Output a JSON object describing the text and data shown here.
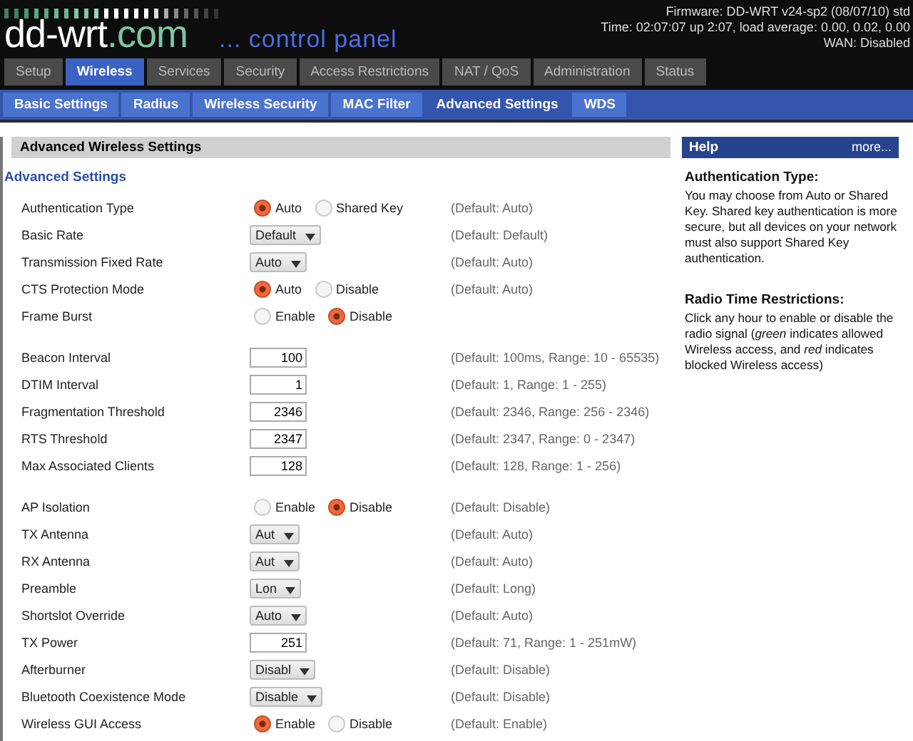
{
  "logo": {
    "name": "dd-wrt",
    "suffix": ".com",
    "tagline": "... control panel"
  },
  "status": [
    "Firmware: DD-WRT v24-sp2 (08/07/10) std",
    "Time: 02:07:07 up 2:07, load average: 0.00, 0.02, 0.00",
    "WAN: Disabled"
  ],
  "tabs": [
    {
      "label": "Setup",
      "selected": false
    },
    {
      "label": "Wireless",
      "selected": true
    },
    {
      "label": "Services",
      "selected": false
    },
    {
      "label": "Security",
      "selected": false
    },
    {
      "label": "Access Restrictions",
      "selected": false
    },
    {
      "label": "NAT / QoS",
      "selected": false
    },
    {
      "label": "Administration",
      "selected": false
    },
    {
      "label": "Status",
      "selected": false
    }
  ],
  "subtabs": [
    {
      "label": "Basic Settings",
      "selected": false
    },
    {
      "label": "Radius",
      "selected": false
    },
    {
      "label": "Wireless Security",
      "selected": false
    },
    {
      "label": "MAC Filter",
      "selected": false
    },
    {
      "label": "Advanced Settings",
      "selected": true
    },
    {
      "label": "WDS",
      "selected": false
    }
  ],
  "section_title": "Advanced Wireless Settings",
  "legend": "Advanced Settings",
  "groups": [
    [
      {
        "label": "Authentication Type",
        "kind": "radio",
        "options": [
          {
            "label": "Auto",
            "selected": true
          },
          {
            "label": "Shared Key",
            "selected": false
          }
        ],
        "default": "(Default: Auto)"
      },
      {
        "label": "Basic Rate",
        "kind": "select",
        "value": "Default",
        "default": "(Default: Default)"
      },
      {
        "label": "Transmission Fixed Rate",
        "kind": "select",
        "value": "Auto",
        "default": "(Default: Auto)"
      },
      {
        "label": "CTS Protection Mode",
        "kind": "radio",
        "options": [
          {
            "label": "Auto",
            "selected": true
          },
          {
            "label": "Disable",
            "selected": false
          }
        ],
        "default": "(Default: Auto)"
      },
      {
        "label": "Frame Burst",
        "kind": "radio",
        "options": [
          {
            "label": "Enable",
            "selected": false
          },
          {
            "label": "Disable",
            "selected": true
          }
        ]
      }
    ],
    [
      {
        "label": "Beacon Interval",
        "kind": "text",
        "value": "100",
        "default": "(Default: 100ms, Range: 10 - 65535)"
      },
      {
        "label": "DTIM Interval",
        "kind": "text",
        "value": "1",
        "default": "(Default: 1, Range: 1 - 255)"
      },
      {
        "label": "Fragmentation Threshold",
        "kind": "text",
        "value": "2346",
        "default": "(Default: 2346, Range: 256 - 2346)"
      },
      {
        "label": "RTS Threshold",
        "kind": "text",
        "value": "2347",
        "default": "(Default: 2347, Range: 0 - 2347)"
      },
      {
        "label": "Max Associated Clients",
        "kind": "text",
        "value": "128",
        "default": "(Default: 128, Range: 1 - 256)"
      }
    ],
    [
      {
        "label": "AP Isolation",
        "kind": "radio",
        "options": [
          {
            "label": "Enable",
            "selected": false
          },
          {
            "label": "Disable",
            "selected": true
          }
        ],
        "default": "(Default: Disable)"
      },
      {
        "label": "TX Antenna",
        "kind": "select",
        "value": "Aut",
        "default": "(Default: Auto)"
      },
      {
        "label": "RX Antenna",
        "kind": "select",
        "value": "Aut",
        "default": "(Default: Auto)"
      },
      {
        "label": "Preamble",
        "kind": "select",
        "value": "Lon",
        "default": "(Default: Long)"
      },
      {
        "label": "Shortslot Override",
        "kind": "select",
        "value": "Auto",
        "default": "(Default: Auto)"
      },
      {
        "label": "TX Power",
        "kind": "text",
        "value": "251",
        "default": "(Default: 71, Range: 1 - 251mW)"
      },
      {
        "label": "Afterburner",
        "kind": "select",
        "value": "Disabl",
        "default": "(Default: Disable)"
      },
      {
        "label": "Bluetooth Coexistence Mode",
        "kind": "select",
        "value": "Disable",
        "default": "(Default: Disable)"
      },
      {
        "label": "Wireless GUI Access",
        "kind": "radio",
        "options": [
          {
            "label": "Enable",
            "selected": true
          },
          {
            "label": "Disable",
            "selected": false
          }
        ],
        "default": "(Default: Enable)"
      }
    ]
  ],
  "help": {
    "title": "Help",
    "more": "more...",
    "sections": [
      {
        "heading": "Authentication Type:",
        "body": "You may choose from Auto or Shared Key. Shared key authentication is more secure, but all devices on your network must also support Shared Key authentication."
      },
      {
        "heading": "Radio Time Restrictions:",
        "body": "Click any hour to enable or disable the radio signal (*green* indicates allowed Wireless access, and *red* indicates blocked Wireless access)"
      }
    ]
  }
}
